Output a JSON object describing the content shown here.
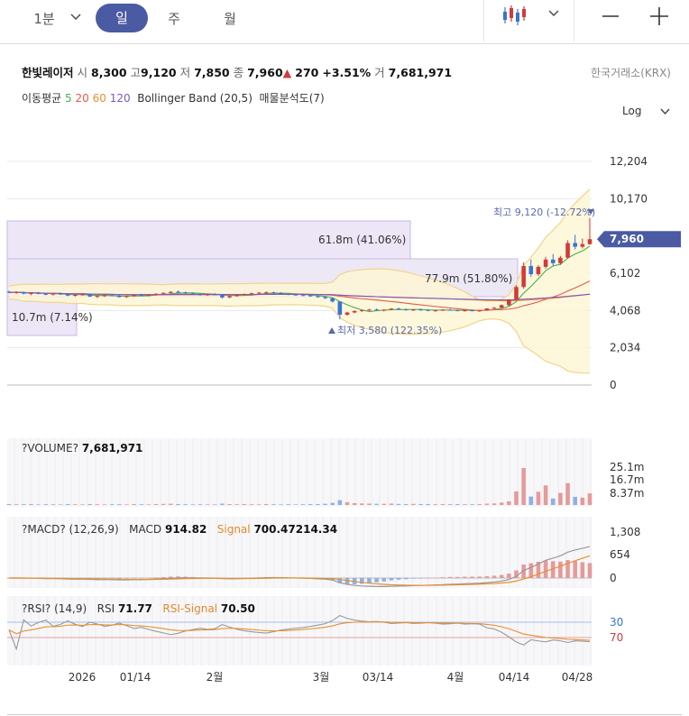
{
  "toolbar": {
    "interval": "1분",
    "tabs": [
      "일",
      "주",
      "월"
    ],
    "active_tab": "일"
  },
  "stock": {
    "name": "한빛레이저",
    "open_label": "시",
    "open": "8,300",
    "high_label": "고",
    "high": "9,120",
    "low_label": "저",
    "low": "7,850",
    "close_label": "종",
    "close": "7,960",
    "change_arrow": "▲",
    "change": "270",
    "change_pct": "+3.51%",
    "volume_label": "거",
    "volume": "7,681,971",
    "exchange": "한국거래소(KRX)"
  },
  "indicators": {
    "ma_label": "이동평균",
    "ma_periods": [
      "5",
      "20",
      "60",
      "120"
    ],
    "ma_colors": [
      "#4caf50",
      "#e35b4c",
      "#e7902f",
      "#7e57c2"
    ],
    "bollinger": "Bollinger Band (20,5)",
    "volume_profile": "매물분석도(7)"
  },
  "scale_label": "Log",
  "colors": {
    "up": "#d23a3a",
    "down": "#3a73d2",
    "accent": "#4a5aa3"
  },
  "chart_data": [
    {
      "type": "candlestick",
      "yticks": [
        "12,204",
        "10,170",
        "6,102",
        "4,068",
        "2,034",
        "0"
      ],
      "current_price": "7,960",
      "annotations": {
        "high": "최고 9,120 (-12.72%)",
        "low": "최저 3,580 (122.35%)",
        "profile_1": "61.8m (41.06%)",
        "profile_2": "77.9m (51.80%)",
        "profile_3": "10.7m (7.14%)"
      },
      "x_labels": [
        "2026",
        "01/14",
        "2월",
        "3월",
        "03/14",
        "4월",
        "04/14",
        "04/28"
      ],
      "candles": [
        [
          5100,
          5150,
          5000,
          5050
        ],
        [
          5050,
          5120,
          4980,
          5080
        ],
        [
          5080,
          5100,
          4950,
          4990
        ],
        [
          4990,
          5060,
          4900,
          5020
        ],
        [
          5020,
          5080,
          4960,
          4980
        ],
        [
          4980,
          5040,
          4900,
          4940
        ],
        [
          4940,
          5010,
          4880,
          4990
        ],
        [
          4990,
          5050,
          4920,
          4960
        ],
        [
          4960,
          5000,
          4850,
          4880
        ],
        [
          4880,
          4950,
          4820,
          4920
        ],
        [
          4920,
          5000,
          4880,
          4950
        ],
        [
          4950,
          4980,
          4800,
          4830
        ],
        [
          4830,
          4900,
          4760,
          4860
        ],
        [
          4860,
          4930,
          4800,
          4900
        ],
        [
          4900,
          4960,
          4850,
          4870
        ],
        [
          4870,
          4920,
          4780,
          4800
        ],
        [
          4800,
          4880,
          4760,
          4850
        ],
        [
          4850,
          4940,
          4820,
          4910
        ],
        [
          4910,
          4980,
          4860,
          4880
        ],
        [
          4880,
          4950,
          4840,
          4930
        ],
        [
          4930,
          5010,
          4900,
          4980
        ],
        [
          4980,
          5060,
          4940,
          5030
        ],
        [
          5030,
          5120,
          5000,
          5090
        ],
        [
          5090,
          5160,
          5040,
          5060
        ],
        [
          5060,
          5100,
          4980,
          5000
        ],
        [
          5000,
          5050,
          4920,
          4960
        ],
        [
          4960,
          5000,
          4880,
          4920
        ],
        [
          4920,
          4980,
          4870,
          4950
        ],
        [
          4950,
          5010,
          4900,
          4930
        ],
        [
          4930,
          4960,
          4720,
          4780
        ],
        [
          4780,
          4880,
          4740,
          4850
        ],
        [
          4850,
          4950,
          4820,
          4920
        ],
        [
          4920,
          5000,
          4890,
          4970
        ],
        [
          4970,
          5040,
          4930,
          5010
        ],
        [
          5010,
          5080,
          4980,
          5040
        ],
        [
          5040,
          5110,
          5000,
          5060
        ],
        [
          5060,
          5100,
          4990,
          5020
        ],
        [
          5020,
          5060,
          4940,
          4970
        ],
        [
          4970,
          5010,
          4900,
          4940
        ],
        [
          4940,
          4990,
          4880,
          4910
        ],
        [
          4910,
          4960,
          4860,
          4890
        ],
        [
          4890,
          4930,
          4820,
          4850
        ],
        [
          4850,
          4900,
          4760,
          4800
        ],
        [
          4800,
          4850,
          4700,
          4740
        ],
        [
          4740,
          4780,
          4500,
          4560
        ],
        [
          4560,
          4560,
          3580,
          3840
        ],
        [
          3840,
          4000,
          3780,
          3960
        ],
        [
          3960,
          4080,
          3920,
          4040
        ],
        [
          4040,
          4120,
          3980,
          4090
        ],
        [
          4090,
          4160,
          4040,
          4120
        ],
        [
          4120,
          4180,
          4060,
          4080
        ],
        [
          4080,
          4140,
          4020,
          4110
        ],
        [
          4110,
          4200,
          4080,
          4170
        ],
        [
          4170,
          4230,
          4100,
          4130
        ],
        [
          4130,
          4180,
          4060,
          4090
        ],
        [
          4090,
          4150,
          4040,
          4120
        ],
        [
          4120,
          4170,
          4070,
          4100
        ],
        [
          4100,
          4150,
          4030,
          4060
        ],
        [
          4060,
          4110,
          4000,
          4080
        ],
        [
          4080,
          4140,
          4040,
          4110
        ],
        [
          4110,
          4160,
          4060,
          4090
        ],
        [
          4090,
          4120,
          4020,
          4050
        ],
        [
          4050,
          4110,
          4010,
          4080
        ],
        [
          4080,
          4130,
          4030,
          4060
        ],
        [
          4060,
          4100,
          4000,
          4070
        ],
        [
          4070,
          4190,
          4050,
          4180
        ],
        [
          4180,
          4260,
          4140,
          4220
        ],
        [
          4220,
          4400,
          4200,
          4360
        ],
        [
          4360,
          4700,
          4300,
          4650
        ],
        [
          4650,
          5450,
          4600,
          5350
        ],
        [
          5350,
          6700,
          5250,
          6500
        ],
        [
          6500,
          6850,
          5900,
          6050
        ],
        [
          6050,
          6550,
          5950,
          6450
        ],
        [
          6450,
          7000,
          6350,
          6850
        ],
        [
          6850,
          7150,
          6500,
          6650
        ],
        [
          6650,
          7050,
          6550,
          6950
        ],
        [
          6950,
          7900,
          6900,
          7750
        ],
        [
          7750,
          8200,
          7400,
          7550
        ],
        [
          7550,
          8000,
          7450,
          7690
        ],
        [
          7690,
          9120,
          7650,
          7960
        ]
      ]
    },
    {
      "type": "bar",
      "name": "?VOLUME?",
      "value": "7,681,971",
      "yticks": [
        "25.1m",
        "16.7m",
        "8.37m"
      ],
      "values_m": [
        0.6,
        0.5,
        0.5,
        0.6,
        0.4,
        0.5,
        0.5,
        0.4,
        0.6,
        0.5,
        0.4,
        0.6,
        0.5,
        0.4,
        0.5,
        0.5,
        0.4,
        0.6,
        0.5,
        0.4,
        0.6,
        0.7,
        0.8,
        0.6,
        0.5,
        0.4,
        0.5,
        0.4,
        0.4,
        0.9,
        0.6,
        0.5,
        0.6,
        0.5,
        0.4,
        0.6,
        0.5,
        0.4,
        0.5,
        0.4,
        0.5,
        0.6,
        0.6,
        0.8,
        1.4,
        3.2,
        1.8,
        1.2,
        1.0,
        0.9,
        0.8,
        0.8,
        0.9,
        0.7,
        0.6,
        0.7,
        0.6,
        0.6,
        0.5,
        0.6,
        0.5,
        0.6,
        0.5,
        0.5,
        0.6,
        0.9,
        1.0,
        1.6,
        2.4,
        9.0,
        24.5,
        5.6,
        8.8,
        13.0,
        4.3,
        8.0,
        14.5,
        5.4,
        4.9,
        7.7
      ]
    },
    {
      "type": "line",
      "name": "?MACD?",
      "params": "(12,26,9)",
      "macd_label": "MACD",
      "macd_value": "914.82",
      "signal_label": "Signal",
      "signal_value": "700.47214.34",
      "yticks": [
        "1,308",
        "654",
        "0"
      ]
    },
    {
      "type": "line",
      "name": "?RSI?",
      "params": "(14,9)",
      "rsi_label": "RSI",
      "rsi_value": "71.77",
      "signal_label": "RSI-Signal",
      "signal_value": "70.50",
      "yticks": [
        "70",
        "30"
      ]
    }
  ]
}
